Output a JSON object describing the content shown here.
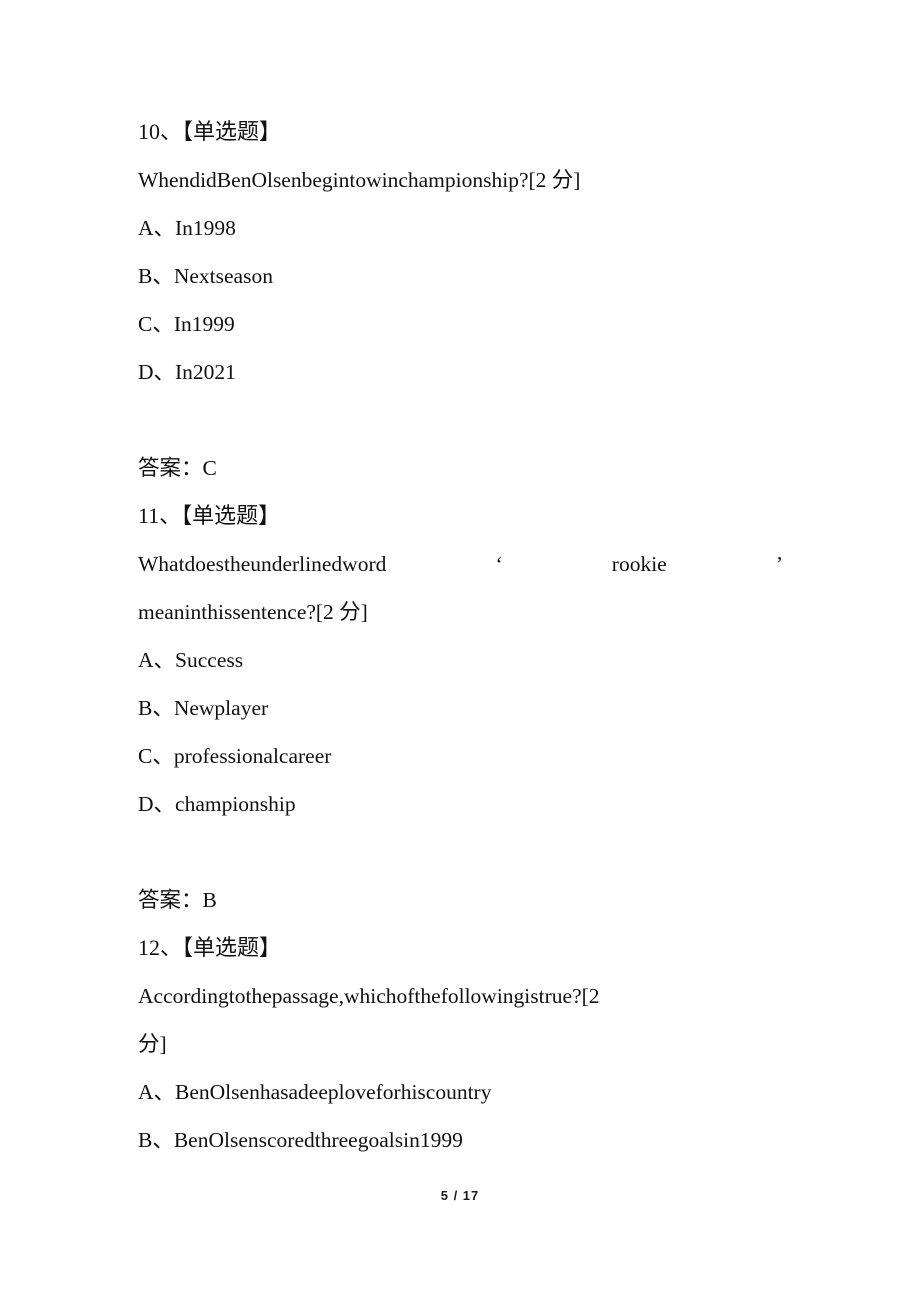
{
  "document": {
    "footer_page_label": "5 / 17",
    "background_color": "#ffffff",
    "text_color": "#111111"
  },
  "questions": [
    {
      "header": "10、【单选题】",
      "stem_lines": [
        "WhendidBenOlsenbegintowinchampionship?[2 分]"
      ],
      "options": [
        "A、In1998",
        "B、Nextseason",
        "C、In1999",
        "D、In2021"
      ],
      "answer": "答案：C"
    },
    {
      "header": "11、【单选题】",
      "stem_lines": [
        "Whatdoestheunderlinedword ‘ rookie ’",
        "meaninthissentence?[2 分]"
      ],
      "options": [
        "A、Success",
        "B、Newplayer",
        "C、professionalcareer",
        "D、championship"
      ],
      "answer": "答案：B"
    },
    {
      "header": "12、【单选题】",
      "stem_lines": [
        "Accordingtothepassage,whichofthefollowingistrue?[2",
        "分]"
      ],
      "options": [
        "A、BenOlsenhasadeeploveforhiscountry",
        "B、BenOlsenscoredthreegoalsin1999"
      ],
      "answer": ""
    }
  ]
}
